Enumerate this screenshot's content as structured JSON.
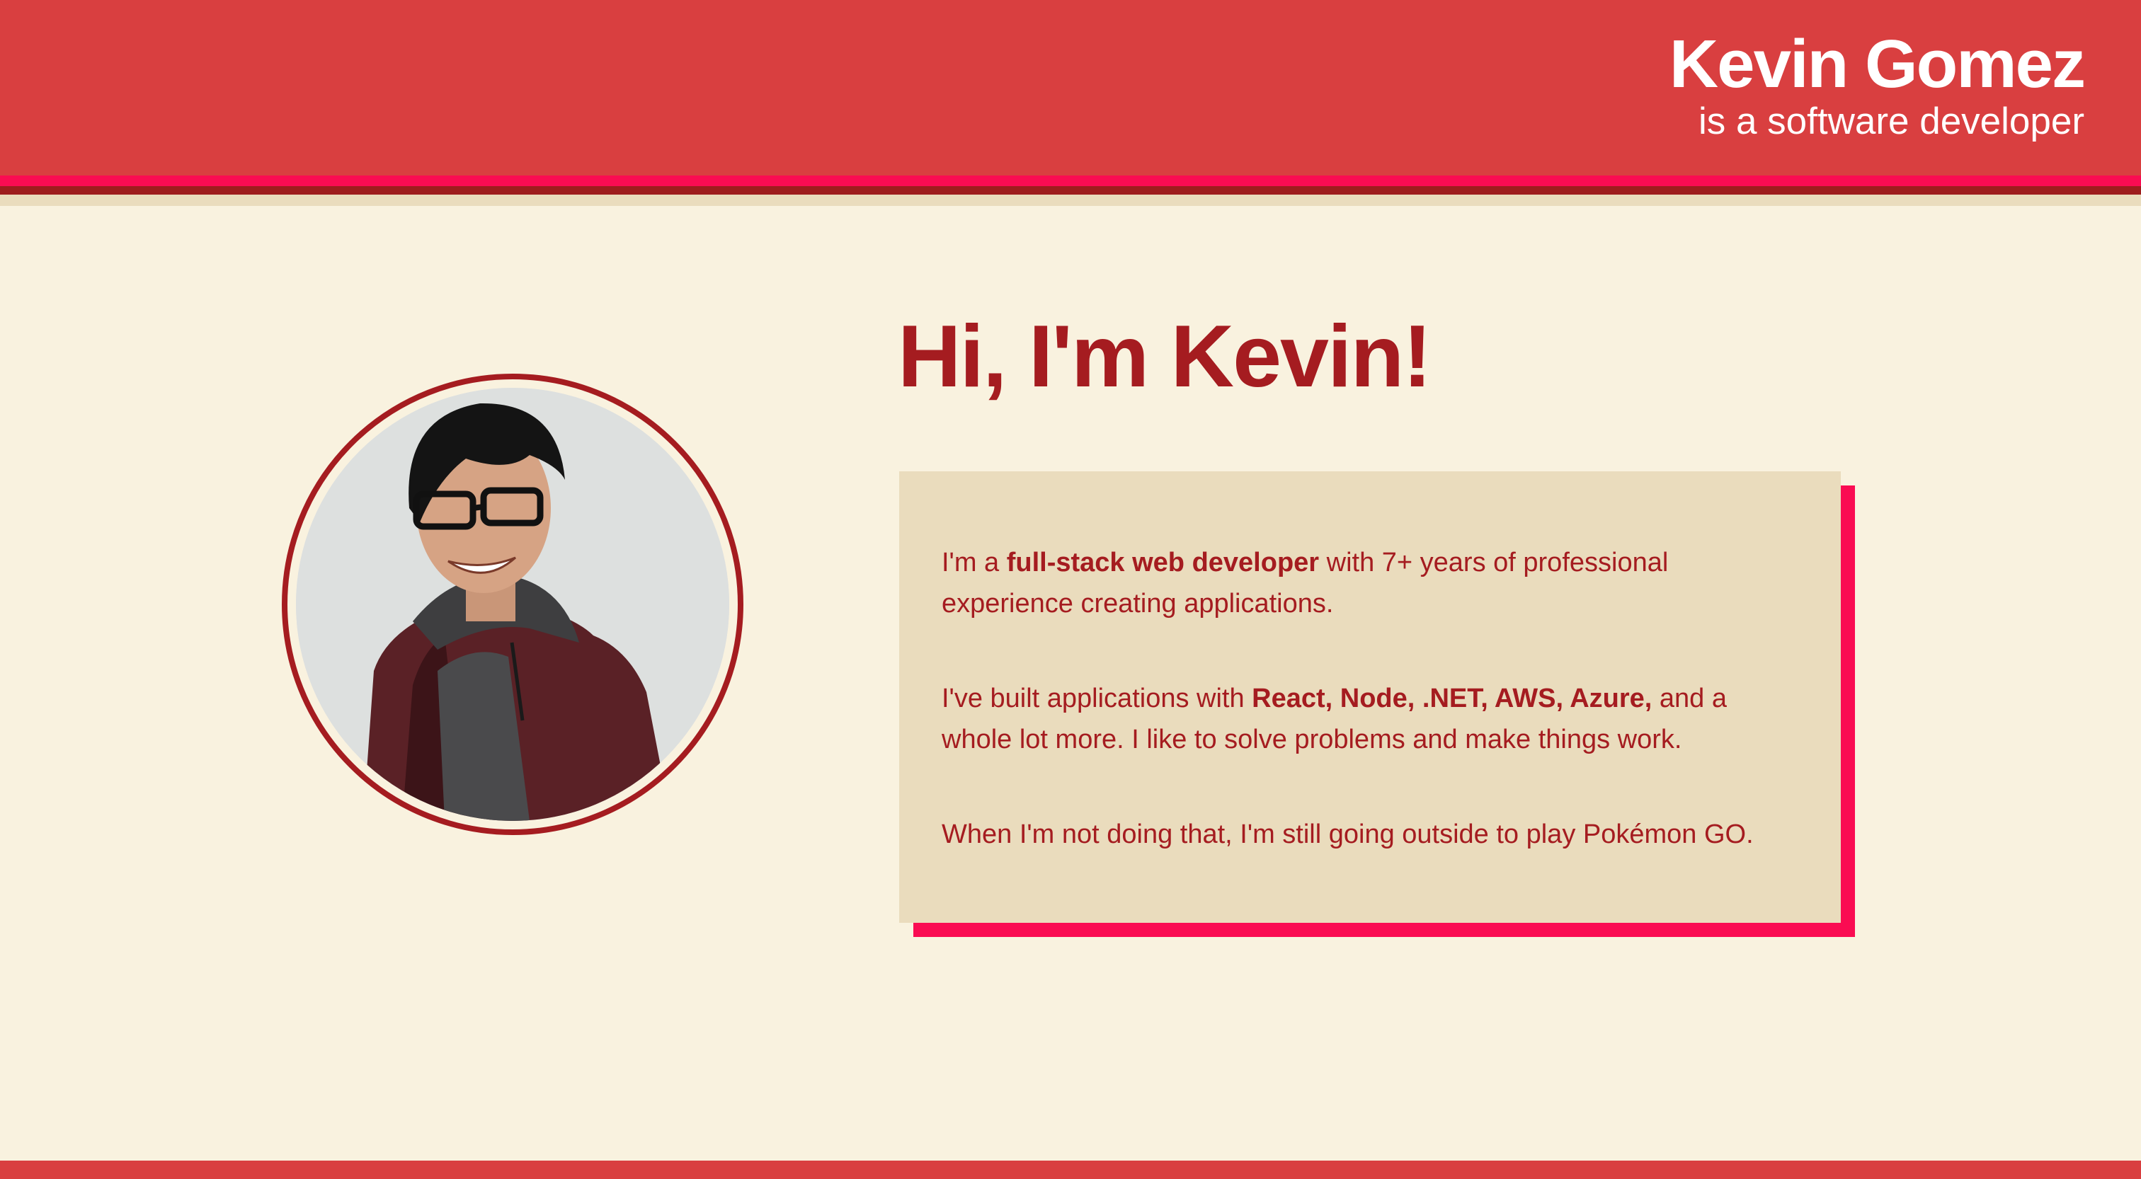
{
  "header": {
    "name": "Kevin Gomez",
    "tagline": "is a software developer"
  },
  "avatar": {
    "alt": "Photo of Kevin Gomez"
  },
  "intro": {
    "heading": "Hi, I'm Kevin!",
    "p1": {
      "before": "I'm a ",
      "strong": "full-stack web developer",
      "after": " with 7+ years of professional experience creating applications."
    },
    "p2": {
      "before": "I've built applications with ",
      "strong": "React, Node, .NET, AWS, Azure,",
      "after": " and a whole lot more. I like to solve problems and make things work."
    },
    "p3": "When I'm not doing that, I'm still going outside to play Pokémon GO."
  },
  "colors": {
    "brand_red": "#d93f40",
    "accent_pink": "#fa0c52",
    "dark_red": "#a51c20",
    "cream": "#f9f2df",
    "tan": "#eadcbd"
  }
}
